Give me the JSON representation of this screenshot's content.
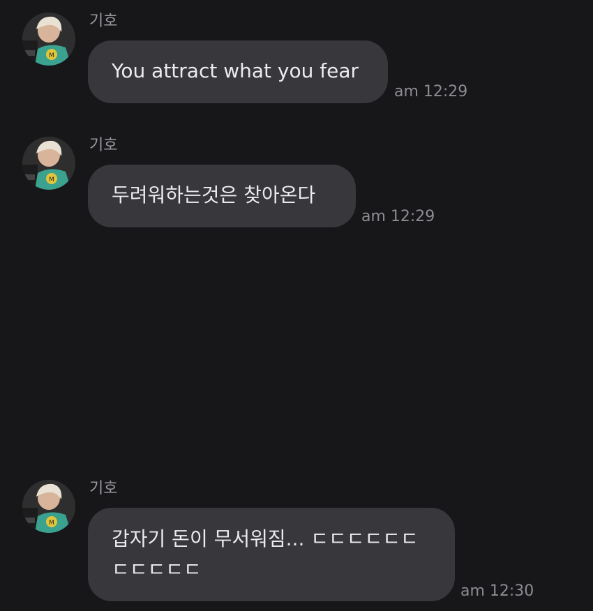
{
  "chat": {
    "messages": [
      {
        "sender": "기호",
        "avatar_icon": "profile-photo-avatar",
        "lines": [
          "You attract what you fear"
        ],
        "time": "am 12:29"
      },
      {
        "sender": "기호",
        "avatar_icon": "profile-photo-avatar",
        "lines": [
          "두려워하는것은 찾아온다"
        ],
        "time": "am 12:29"
      },
      {
        "sender": "기호",
        "avatar_icon": "profile-photo-avatar",
        "lines": [
          "갑자기 돈이 무서워짐... ㄷㄷㄷㄷㄷㄷ",
          "ㄷㄷㄷㄷㄷ"
        ],
        "time": "am 12:30"
      }
    ]
  },
  "colors": {
    "background": "#17171a",
    "bubble": "#37373c",
    "text": "#ececef",
    "meta": "#8c8c92"
  }
}
